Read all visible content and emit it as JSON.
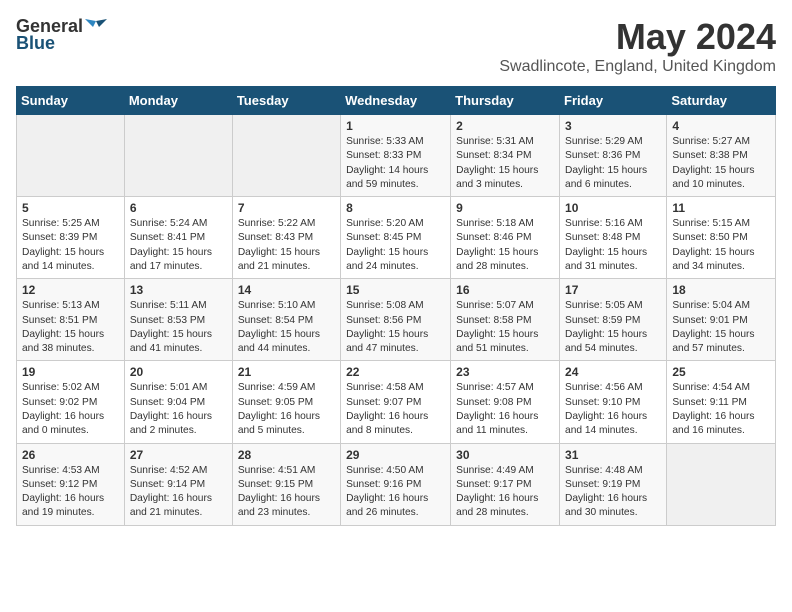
{
  "header": {
    "logo_general": "General",
    "logo_blue": "Blue",
    "title": "May 2024",
    "subtitle": "Swadlincote, England, United Kingdom"
  },
  "days_of_week": [
    "Sunday",
    "Monday",
    "Tuesday",
    "Wednesday",
    "Thursday",
    "Friday",
    "Saturday"
  ],
  "weeks": [
    [
      {
        "day": "",
        "info": ""
      },
      {
        "day": "",
        "info": ""
      },
      {
        "day": "",
        "info": ""
      },
      {
        "day": "1",
        "info": "Sunrise: 5:33 AM\nSunset: 8:33 PM\nDaylight: 14 hours\nand 59 minutes."
      },
      {
        "day": "2",
        "info": "Sunrise: 5:31 AM\nSunset: 8:34 PM\nDaylight: 15 hours\nand 3 minutes."
      },
      {
        "day": "3",
        "info": "Sunrise: 5:29 AM\nSunset: 8:36 PM\nDaylight: 15 hours\nand 6 minutes."
      },
      {
        "day": "4",
        "info": "Sunrise: 5:27 AM\nSunset: 8:38 PM\nDaylight: 15 hours\nand 10 minutes."
      }
    ],
    [
      {
        "day": "5",
        "info": "Sunrise: 5:25 AM\nSunset: 8:39 PM\nDaylight: 15 hours\nand 14 minutes."
      },
      {
        "day": "6",
        "info": "Sunrise: 5:24 AM\nSunset: 8:41 PM\nDaylight: 15 hours\nand 17 minutes."
      },
      {
        "day": "7",
        "info": "Sunrise: 5:22 AM\nSunset: 8:43 PM\nDaylight: 15 hours\nand 21 minutes."
      },
      {
        "day": "8",
        "info": "Sunrise: 5:20 AM\nSunset: 8:45 PM\nDaylight: 15 hours\nand 24 minutes."
      },
      {
        "day": "9",
        "info": "Sunrise: 5:18 AM\nSunset: 8:46 PM\nDaylight: 15 hours\nand 28 minutes."
      },
      {
        "day": "10",
        "info": "Sunrise: 5:16 AM\nSunset: 8:48 PM\nDaylight: 15 hours\nand 31 minutes."
      },
      {
        "day": "11",
        "info": "Sunrise: 5:15 AM\nSunset: 8:50 PM\nDaylight: 15 hours\nand 34 minutes."
      }
    ],
    [
      {
        "day": "12",
        "info": "Sunrise: 5:13 AM\nSunset: 8:51 PM\nDaylight: 15 hours\nand 38 minutes."
      },
      {
        "day": "13",
        "info": "Sunrise: 5:11 AM\nSunset: 8:53 PM\nDaylight: 15 hours\nand 41 minutes."
      },
      {
        "day": "14",
        "info": "Sunrise: 5:10 AM\nSunset: 8:54 PM\nDaylight: 15 hours\nand 44 minutes."
      },
      {
        "day": "15",
        "info": "Sunrise: 5:08 AM\nSunset: 8:56 PM\nDaylight: 15 hours\nand 47 minutes."
      },
      {
        "day": "16",
        "info": "Sunrise: 5:07 AM\nSunset: 8:58 PM\nDaylight: 15 hours\nand 51 minutes."
      },
      {
        "day": "17",
        "info": "Sunrise: 5:05 AM\nSunset: 8:59 PM\nDaylight: 15 hours\nand 54 minutes."
      },
      {
        "day": "18",
        "info": "Sunrise: 5:04 AM\nSunset: 9:01 PM\nDaylight: 15 hours\nand 57 minutes."
      }
    ],
    [
      {
        "day": "19",
        "info": "Sunrise: 5:02 AM\nSunset: 9:02 PM\nDaylight: 16 hours\nand 0 minutes."
      },
      {
        "day": "20",
        "info": "Sunrise: 5:01 AM\nSunset: 9:04 PM\nDaylight: 16 hours\nand 2 minutes."
      },
      {
        "day": "21",
        "info": "Sunrise: 4:59 AM\nSunset: 9:05 PM\nDaylight: 16 hours\nand 5 minutes."
      },
      {
        "day": "22",
        "info": "Sunrise: 4:58 AM\nSunset: 9:07 PM\nDaylight: 16 hours\nand 8 minutes."
      },
      {
        "day": "23",
        "info": "Sunrise: 4:57 AM\nSunset: 9:08 PM\nDaylight: 16 hours\nand 11 minutes."
      },
      {
        "day": "24",
        "info": "Sunrise: 4:56 AM\nSunset: 9:10 PM\nDaylight: 16 hours\nand 14 minutes."
      },
      {
        "day": "25",
        "info": "Sunrise: 4:54 AM\nSunset: 9:11 PM\nDaylight: 16 hours\nand 16 minutes."
      }
    ],
    [
      {
        "day": "26",
        "info": "Sunrise: 4:53 AM\nSunset: 9:12 PM\nDaylight: 16 hours\nand 19 minutes."
      },
      {
        "day": "27",
        "info": "Sunrise: 4:52 AM\nSunset: 9:14 PM\nDaylight: 16 hours\nand 21 minutes."
      },
      {
        "day": "28",
        "info": "Sunrise: 4:51 AM\nSunset: 9:15 PM\nDaylight: 16 hours\nand 23 minutes."
      },
      {
        "day": "29",
        "info": "Sunrise: 4:50 AM\nSunset: 9:16 PM\nDaylight: 16 hours\nand 26 minutes."
      },
      {
        "day": "30",
        "info": "Sunrise: 4:49 AM\nSunset: 9:17 PM\nDaylight: 16 hours\nand 28 minutes."
      },
      {
        "day": "31",
        "info": "Sunrise: 4:48 AM\nSunset: 9:19 PM\nDaylight: 16 hours\nand 30 minutes."
      },
      {
        "day": "",
        "info": ""
      }
    ]
  ]
}
